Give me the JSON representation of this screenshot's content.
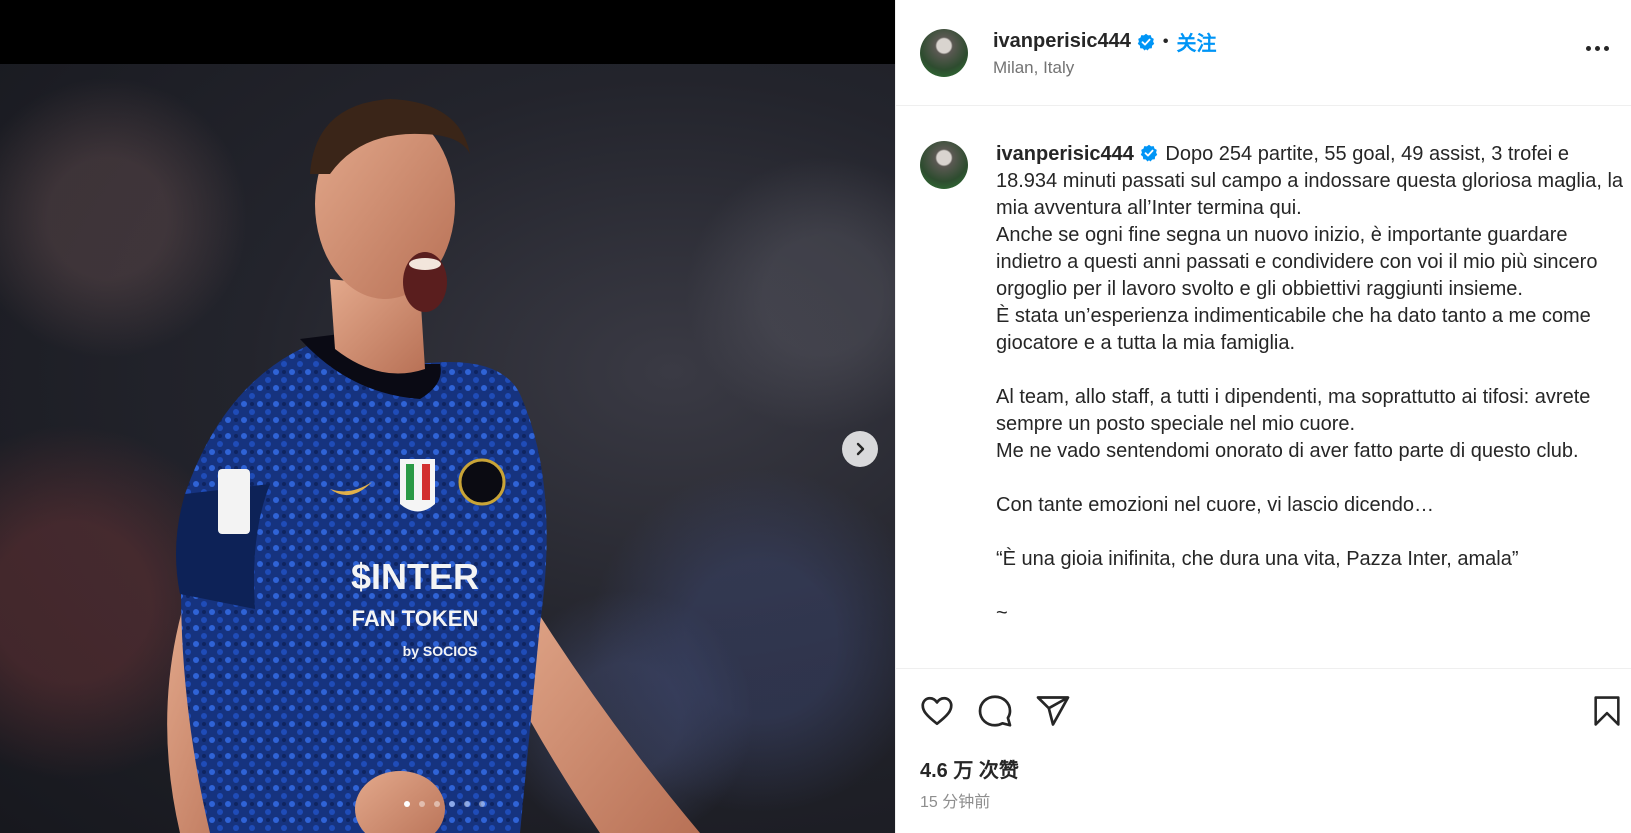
{
  "post": {
    "username": "ivanperisic444",
    "follow_label": "关注",
    "separator": "•",
    "location": "Milan, Italy",
    "caption_user": "ivanperisic444",
    "caption_text": " Dopo 254 partite, 55 goal, 49 assist, 3 trofei e 18.934 minuti passati sul campo a indossare questa gloriosa maglia, la mia avventura all’Inter termina qui.\nAnche se ogni fine segna un nuovo inizio, è importante guardare indietro a questi anni passati e condividere con voi il mio più sincero orgoglio per il lavoro svolto e gli obbiettivi raggiunti insieme.\nÈ stata un’esperienza indimenticabile che ha dato tanto a me come giocatore e a tutta la mia famiglia.\n\nAl team, allo staff, a tutti i dipendenti, ma soprattutto ai tifosi: avrete sempre un posto speciale nel mio cuore.\nMe ne vado sentendomi onorato di aver fatto parte di questo club.\n\nCon tante emozioni nel cuore, vi lascio dicendo…\n\n“È una gioia inifinita, che dura una vita, Pazza Inter, amala”\n\n~",
    "likes": "4.6 万 次赞",
    "time_ago": "15 分钟前"
  },
  "carousel": {
    "slide_count": 6,
    "active_index": 0
  },
  "photo_text": {
    "sponsor_line1": "$INTER",
    "sponsor_line2": "FAN TOKEN",
    "sponsor_line3": "by SOCIOS"
  },
  "icons": {
    "next": "chevron-right-icon",
    "like": "heart-icon",
    "comment": "comment-icon",
    "share": "paper-plane-icon",
    "save": "bookmark-icon",
    "more": "more-horizontal-icon",
    "verified": "verified-badge-icon"
  },
  "colors": {
    "accent": "#0095f6",
    "text": "#262626",
    "muted": "#737373",
    "jersey_blue": "#1b3f9c"
  }
}
